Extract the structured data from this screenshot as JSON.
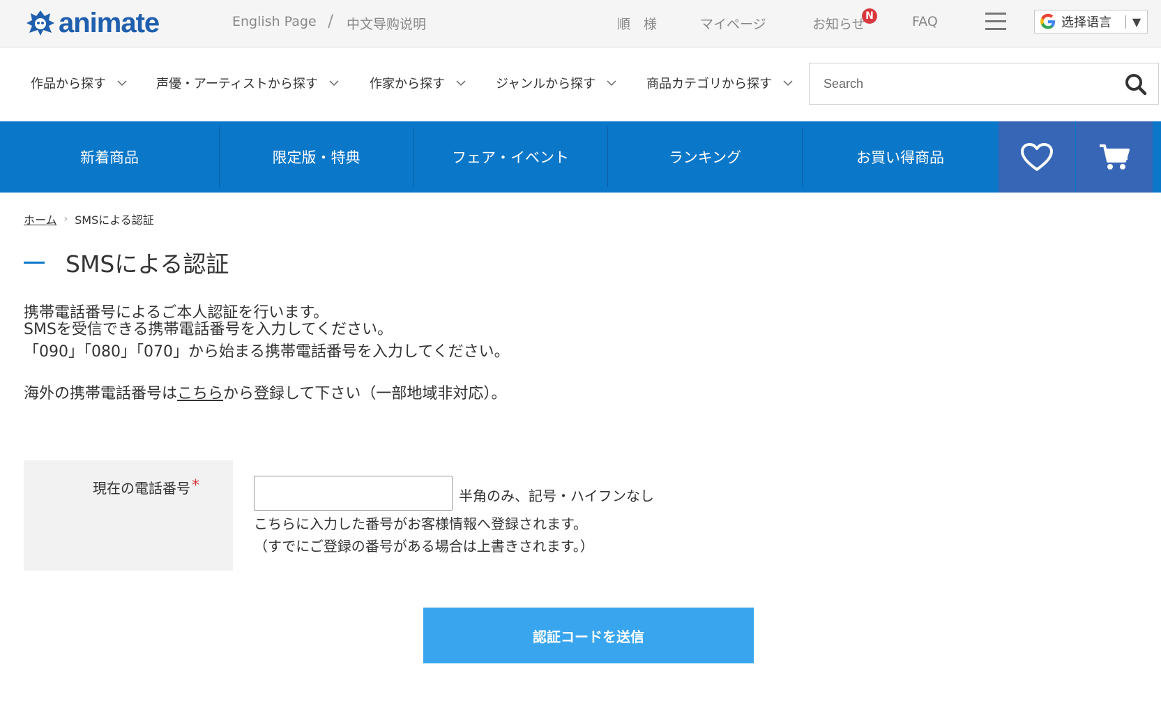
{
  "header": {
    "logo_text": "animate",
    "links": {
      "english": "English Page",
      "separator": "/",
      "chinese": "中文导购说明",
      "user": "順　様",
      "mypage": "マイページ",
      "notice": "お知らせ",
      "notice_badge": "N",
      "faq": "FAQ"
    },
    "language": {
      "label": "选择语言",
      "arrow": "▼"
    }
  },
  "category_nav": {
    "items": [
      {
        "label": "作品から探す"
      },
      {
        "label": "声優・アーティストから探す"
      },
      {
        "label": "作家から探す"
      },
      {
        "label": "ジャンルから探す"
      },
      {
        "label": "商品カテゴリから探す"
      }
    ],
    "search": {
      "placeholder": "Search"
    }
  },
  "main_nav": {
    "items": [
      {
        "label": "新着商品"
      },
      {
        "label": "限定版・特典"
      },
      {
        "label": "フェア・イベント"
      },
      {
        "label": "ランキング"
      },
      {
        "label": "お買い得商品"
      }
    ]
  },
  "breadcrumb": {
    "home": "ホーム",
    "separator": "›",
    "current": "SMSによる認証"
  },
  "page": {
    "title": "SMSによる認証",
    "intro": {
      "line1": "携帯電話番号によるご本人認証を行います。",
      "line2": "SMSを受信できる携帯電話番号を入力してください。",
      "line3": "「090」「080」「070」から始まる携帯電話番号を入力してください。",
      "line4_before": "海外の携帯電話番号は",
      "line4_link": "こちら",
      "line4_after": "から登録して下さい（一部地域非対応）。"
    },
    "form": {
      "phone_label": "現在の電話番号",
      "required_mark": "*",
      "phone_value": "",
      "hint": "半角のみ、記号・ハイフンなし",
      "note1": "こちらに入力した番号がお客様情報へ登録されます。",
      "note2": "（すでにご登録の番号がある場合は上書きされます。）"
    },
    "submit_label": "認証コードを送信"
  }
}
